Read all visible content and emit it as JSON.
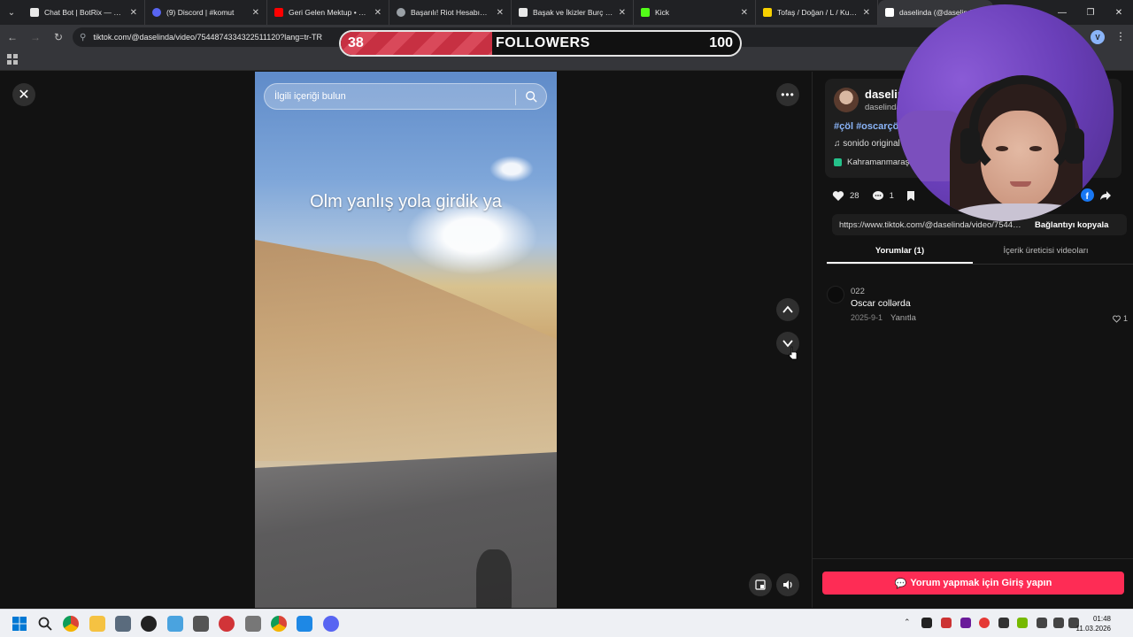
{
  "browser": {
    "tabs": [
      {
        "label": "Chat Bot | BotRix — Clou",
        "color": "#e8e8e8"
      },
      {
        "label": "(9) Discord | #komut",
        "color": "#5865f2"
      },
      {
        "label": "Geri Gelen Mektup • Gün",
        "color": "#ff0000"
      },
      {
        "label": "Başarılı! Riot Hesabın Artık",
        "color": "#9aa0a6"
      },
      {
        "label": "Başak ve İkizler Burç Uyum",
        "color": "#e8e8e8"
      },
      {
        "label": "Kick",
        "color": "#53fc18"
      },
      {
        "label": "Tofaş / Doğan / L / Kusur",
        "color": "#f7d000"
      },
      {
        "label": "daselinda (@daselinda",
        "color": "#ffffff"
      }
    ],
    "url": "tiktok.com/@daselinda/video/7544874334322511120?lang=tr-TR",
    "profile_initial": "V"
  },
  "overlay": {
    "current": "38",
    "label": "FOLLOWERS",
    "goal": "100",
    "progress": 0.38
  },
  "video": {
    "search_placeholder": "İlgili içeriği bulun",
    "caption": "Olm yanlış yola girdik ya"
  },
  "panel": {
    "display_name": "daselin",
    "username": "daselinda",
    "hashtags": "#çöl #oscarçöl",
    "sound": "sonido original",
    "location": "Kahramanmaraş",
    "likes": "28",
    "comments_count": "1",
    "link_url": "https://www.tiktok.com/@daselinda/video/7544874334322511120",
    "copy_link": "Bağlantıyı kopyala",
    "tab_comments": "Yorumlar (1)",
    "tab_creator": "İçerik üreticisi videoları",
    "comment": {
      "user": "022",
      "text": "Oscar collərda",
      "date": "2025-9-1",
      "reply": "Yanıtla",
      "likes": "1"
    },
    "login_cta": "Yorum yapmak için Giriş yapın"
  },
  "taskbar": {
    "time": "01:48",
    "date": "11.03.2026"
  },
  "icons": [
    "chevron-down-icon",
    "close-icon",
    "back-icon",
    "forward-icon",
    "reload-icon",
    "apps-icon",
    "search-icon",
    "more-icon",
    "chevron-up-icon",
    "pip-icon",
    "volume-icon",
    "heart-icon",
    "comment-icon",
    "bookmark-icon",
    "facebook-icon",
    "share-icon",
    "music-note-icon",
    "windows-icon",
    "chrome-icon",
    "folder-icon"
  ]
}
